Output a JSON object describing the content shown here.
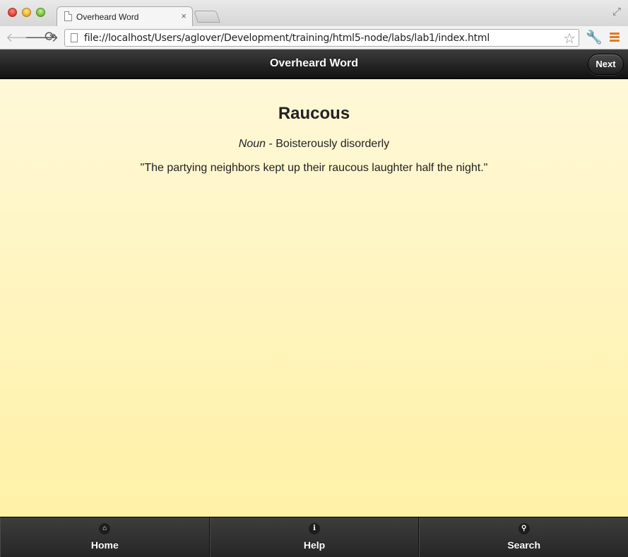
{
  "browser": {
    "tab_title": "Overheard Word",
    "tab_close": "×",
    "url": "file://localhost/Users/aglover/Development/training/html5-node/labs/lab1/index.html",
    "icons": {
      "back": "back-arrow-icon",
      "forward": "forward-arrow-icon",
      "reload": "reload-icon",
      "bookmark": "star-icon",
      "wrench": "wrench-icon",
      "menu": "menu-icon",
      "fullscreen": "fullscreen-icon"
    }
  },
  "header": {
    "title": "Overheard Word",
    "next_label": "Next"
  },
  "word": {
    "title": "Raucous",
    "part_of_speech": "Noun",
    "separator": " - ",
    "definition": "Boisterously disorderly",
    "example": "\"The partying neighbors kept up their raucous laughter half the night.\""
  },
  "footer": {
    "items": [
      {
        "label": "Home",
        "icon": "home-icon"
      },
      {
        "label": "Help",
        "icon": "info-icon"
      },
      {
        "label": "Search",
        "icon": "search-icon"
      }
    ]
  },
  "colors": {
    "content_top": "#fff8d8",
    "content_bottom": "#fff1a6",
    "bar_dark": "#222222",
    "menu_accent": "#e07b22"
  }
}
